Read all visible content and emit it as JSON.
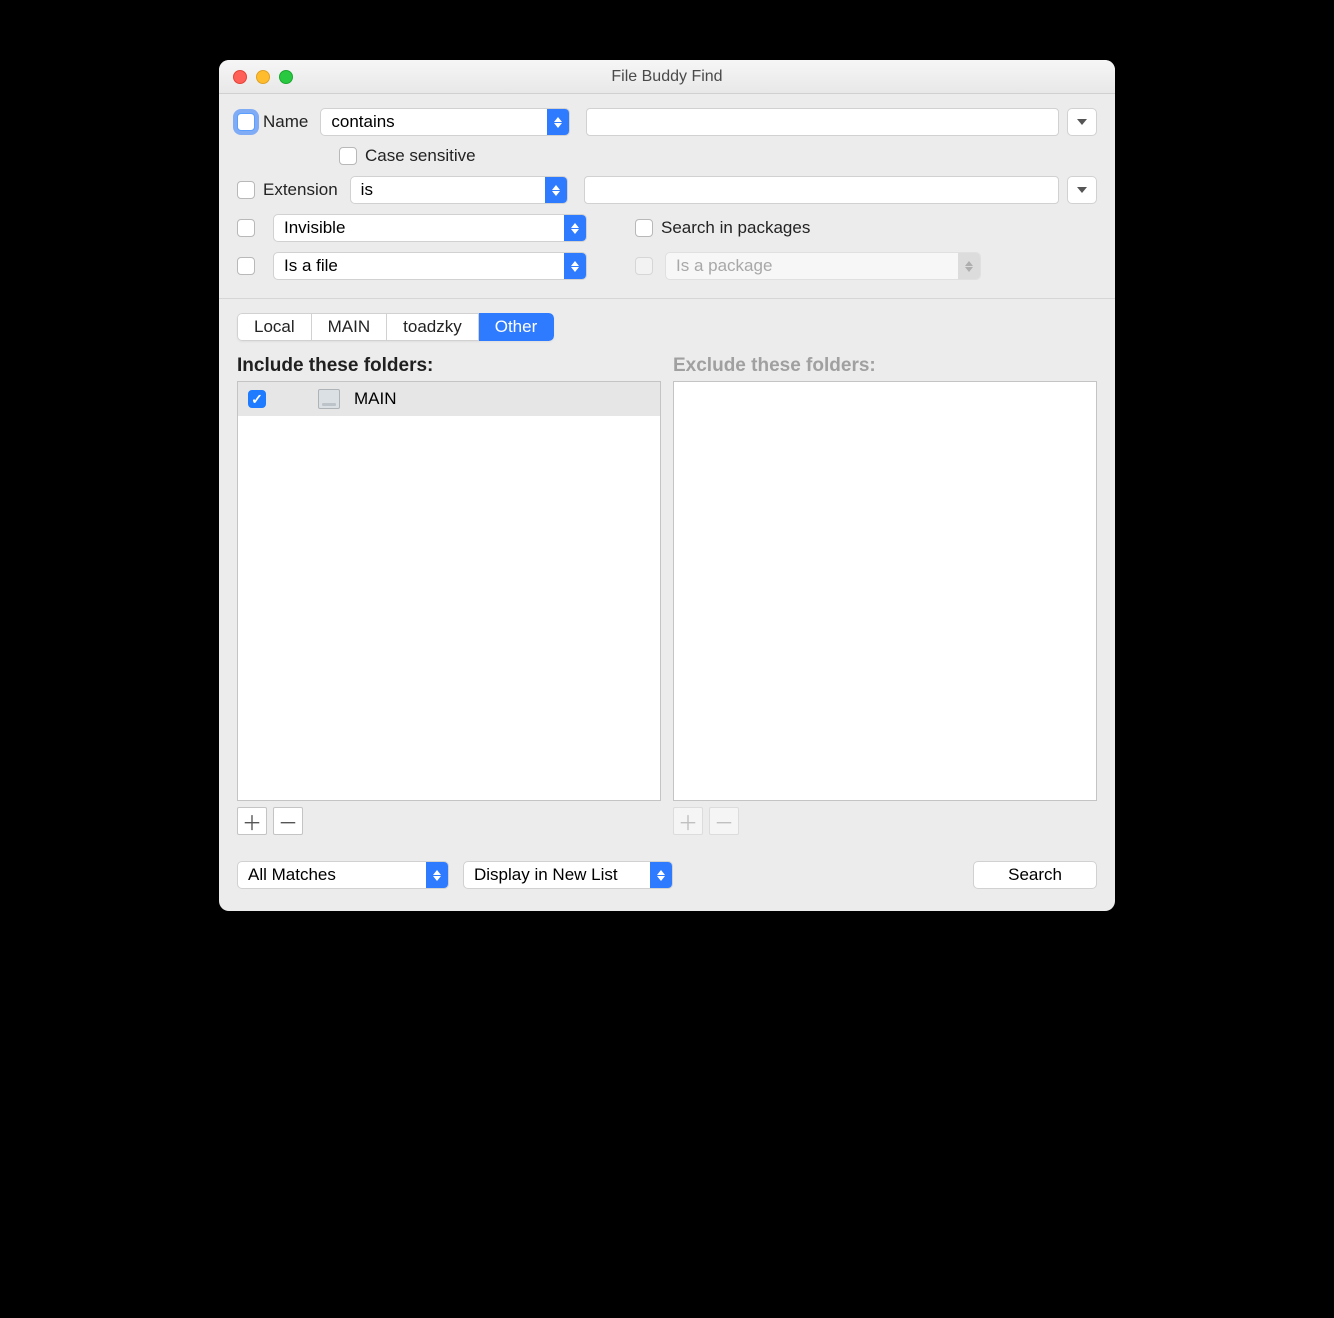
{
  "window": {
    "title": "File Buddy Find"
  },
  "criteria": {
    "name_label": "Name",
    "name_op": "contains",
    "name_value": "",
    "case_sensitive_label": "Case sensitive",
    "extension_label": "Extension",
    "extension_op": "is",
    "extension_value": "",
    "invisible_op": "Invisible",
    "isfile_op": "Is a file",
    "search_in_packages_label": "Search in packages",
    "is_package_op": "Is a package"
  },
  "tabs": {
    "items": [
      "Local",
      "MAIN",
      "toadzky",
      "Other"
    ],
    "selected_index": 3
  },
  "include": {
    "title": "Include these folders:",
    "items": [
      {
        "checked": true,
        "label": "MAIN"
      }
    ]
  },
  "exclude": {
    "title": "Exclude these folders:"
  },
  "bottom": {
    "matches": "All Matches",
    "display": "Display in New List",
    "search": "Search"
  },
  "glyphs": {
    "plus": "＋",
    "minus": "－"
  }
}
